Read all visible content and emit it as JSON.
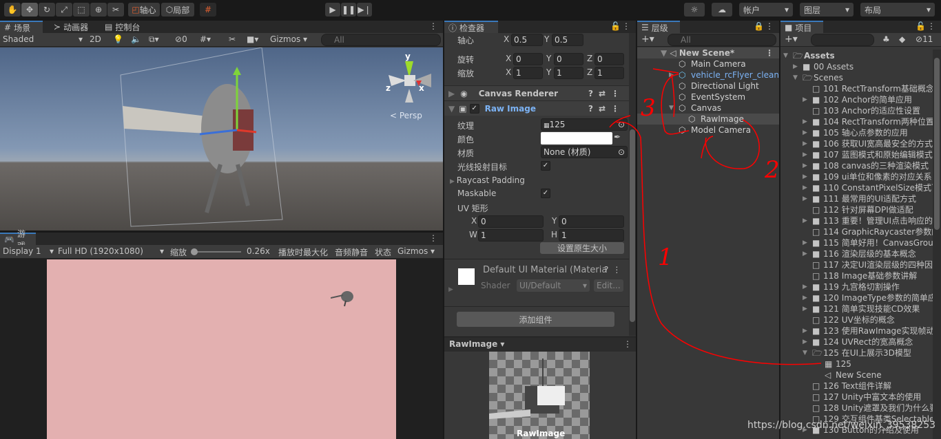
{
  "toolbar": {
    "tools": [
      "hand-icon",
      "move-icon",
      "rotate-icon",
      "scale-icon",
      "rect-icon",
      "transform-icon",
      "custom-tool-icon"
    ],
    "pivot": "轴心",
    "local": "局部",
    "account": "帐户",
    "layers": "图层",
    "layout": "布局"
  },
  "scene": {
    "tabs": [
      "场景",
      "动画器",
      "控制台"
    ],
    "shading": "Shaded",
    "mode2d": "2D",
    "hidden_count": "0",
    "gizmos": "Gizmos",
    "search_placeholder": "All",
    "persp": "Persp",
    "axis_y": "y",
    "axis_x": "x",
    "axis_z": "z"
  },
  "game": {
    "tab": "游戏",
    "display": "Display 1",
    "resolution": "Full HD (1920x1080)",
    "scale_label": "缩放",
    "scale_value": "0.26x",
    "scale_fraction": 0.0,
    "maximize": "播放时最大化",
    "mute": "音频静音",
    "stats": "状态",
    "gizmos": "Gizmos",
    "bg_color": "#e3b0b0"
  },
  "inspector": {
    "tab": "检查器",
    "pivot": {
      "label": "轴心",
      "x": "0.5",
      "y": "0.5"
    },
    "rotation": {
      "label": "旋转",
      "x": "0",
      "y": "0",
      "z": "0"
    },
    "scale": {
      "label": "缩放",
      "x": "1",
      "y": "1",
      "z": "1"
    },
    "canvas_renderer": "Canvas Renderer",
    "raw_image": "Raw Image",
    "texture": {
      "label": "纹理",
      "value": "125"
    },
    "color": {
      "label": "颜色",
      "value": "#ffffff"
    },
    "material": {
      "label": "材质",
      "value": "None (材质)"
    },
    "raycast_target": {
      "label": "光线投射目标",
      "checked": true
    },
    "raycast_padding": "Raycast Padding",
    "maskable": {
      "label": "Maskable",
      "checked": true
    },
    "uv_rect": {
      "label": "UV 矩形",
      "x": "0",
      "y": "0",
      "w": "1",
      "h": "1"
    },
    "set_native": "设置原生大小",
    "mat_title": "Default UI Material (Materia",
    "shader_label": "Shader",
    "shader": "UI/Default",
    "edit": "Edit...",
    "add_component": "添加组件",
    "preview_title": "RawImage",
    "preview_caption": "RawImage"
  },
  "hierarchy": {
    "tab": "层级",
    "search_placeholder": "All",
    "scene": "New Scene*",
    "items": [
      "Main Camera",
      "vehicle_rcFlyer_clean",
      "Directional Light",
      "EventSystem",
      "Canvas",
      "RawImage",
      "Model Camera"
    ]
  },
  "project": {
    "tab": "项目",
    "hidden_count": "11",
    "items": [
      {
        "t": "Assets",
        "lvl": 0,
        "kind": "open",
        "arrow": "down"
      },
      {
        "t": "00 Assets",
        "lvl": 1,
        "kind": "fill",
        "arrow": "right"
      },
      {
        "t": "Scenes",
        "lvl": 1,
        "kind": "open",
        "arrow": "down"
      },
      {
        "t": "101 RectTransform基础概念",
        "lvl": 2,
        "kind": "empty"
      },
      {
        "t": "102 Anchor的简单应用",
        "lvl": 2,
        "kind": "fill",
        "arrow": "right"
      },
      {
        "t": "103 Anchor的适应性设置",
        "lvl": 2,
        "kind": "empty"
      },
      {
        "t": "104 RectTransform两种位置",
        "lvl": 2,
        "kind": "fill",
        "arrow": "right"
      },
      {
        "t": "105 轴心点参数的应用",
        "lvl": 2,
        "kind": "fill",
        "arrow": "right"
      },
      {
        "t": "106 获取UI宽高最安全的方式",
        "lvl": 2,
        "kind": "fill",
        "arrow": "right"
      },
      {
        "t": "107 蓝图模式和原始编辑模式",
        "lvl": 2,
        "kind": "fill",
        "arrow": "right"
      },
      {
        "t": "108 canvas的三种渲染模式",
        "lvl": 2,
        "kind": "fill",
        "arrow": "right"
      },
      {
        "t": "109 ui单位和像素的对应关系",
        "lvl": 2,
        "kind": "fill",
        "arrow": "right"
      },
      {
        "t": "110 ConstantPixelSize模式下",
        "lvl": 2,
        "kind": "fill",
        "arrow": "right"
      },
      {
        "t": "111 最常用的UI适配方式",
        "lvl": 2,
        "kind": "fill",
        "arrow": "right"
      },
      {
        "t": "112 针对屏幕DPI做适配",
        "lvl": 2,
        "kind": "empty"
      },
      {
        "t": "113 重要！管理UI点击响应的",
        "lvl": 2,
        "kind": "fill",
        "arrow": "right"
      },
      {
        "t": "114 GraphicRaycaster参数的",
        "lvl": 2,
        "kind": "empty"
      },
      {
        "t": "115 简单好用！CanvasGroup",
        "lvl": 2,
        "kind": "fill",
        "arrow": "right"
      },
      {
        "t": "116 渲染层级的基本概念",
        "lvl": 2,
        "kind": "fill",
        "arrow": "right"
      },
      {
        "t": "117 决定UI渲染层级的四种因",
        "lvl": 2,
        "kind": "empty"
      },
      {
        "t": "118 Image基础参数讲解",
        "lvl": 2,
        "kind": "empty"
      },
      {
        "t": "119 九宫格切割操作",
        "lvl": 2,
        "kind": "fill",
        "arrow": "right"
      },
      {
        "t": "120 ImageType参数的简单应",
        "lvl": 2,
        "kind": "fill",
        "arrow": "right"
      },
      {
        "t": "121 简单实现技能CD效果",
        "lvl": 2,
        "kind": "fill",
        "arrow": "right"
      },
      {
        "t": "122 UV坐标的概念",
        "lvl": 2,
        "kind": "empty"
      },
      {
        "t": "123 使用RawImage实现帧动",
        "lvl": 2,
        "kind": "fill",
        "arrow": "right"
      },
      {
        "t": "124 UVRect的宽高概念",
        "lvl": 2,
        "kind": "fill",
        "arrow": "right"
      },
      {
        "t": "125 在UI上展示3D模型",
        "lvl": 2,
        "kind": "open",
        "arrow": "down"
      },
      {
        "t": "125",
        "lvl": 3,
        "kind": "texture"
      },
      {
        "t": "New Scene",
        "lvl": 3,
        "kind": "scene"
      },
      {
        "t": "126 Text组件详解",
        "lvl": 2,
        "kind": "empty"
      },
      {
        "t": "127 Unity中富文本的使用",
        "lvl": 2,
        "kind": "empty"
      },
      {
        "t": "128 Unity遮罩及我们为什么要",
        "lvl": 2,
        "kind": "empty"
      },
      {
        "t": "129 交互组件基类Selectable",
        "lvl": 2,
        "kind": "empty"
      },
      {
        "t": "130 Button的介绍及使用",
        "lvl": 2,
        "kind": "fill",
        "arrow": "right"
      }
    ]
  },
  "annotations": {
    "color": "#ff0000",
    "marks": [
      "1",
      "2",
      "3"
    ]
  },
  "watermark": "https://blog.csdn.net/weixin_39538253"
}
